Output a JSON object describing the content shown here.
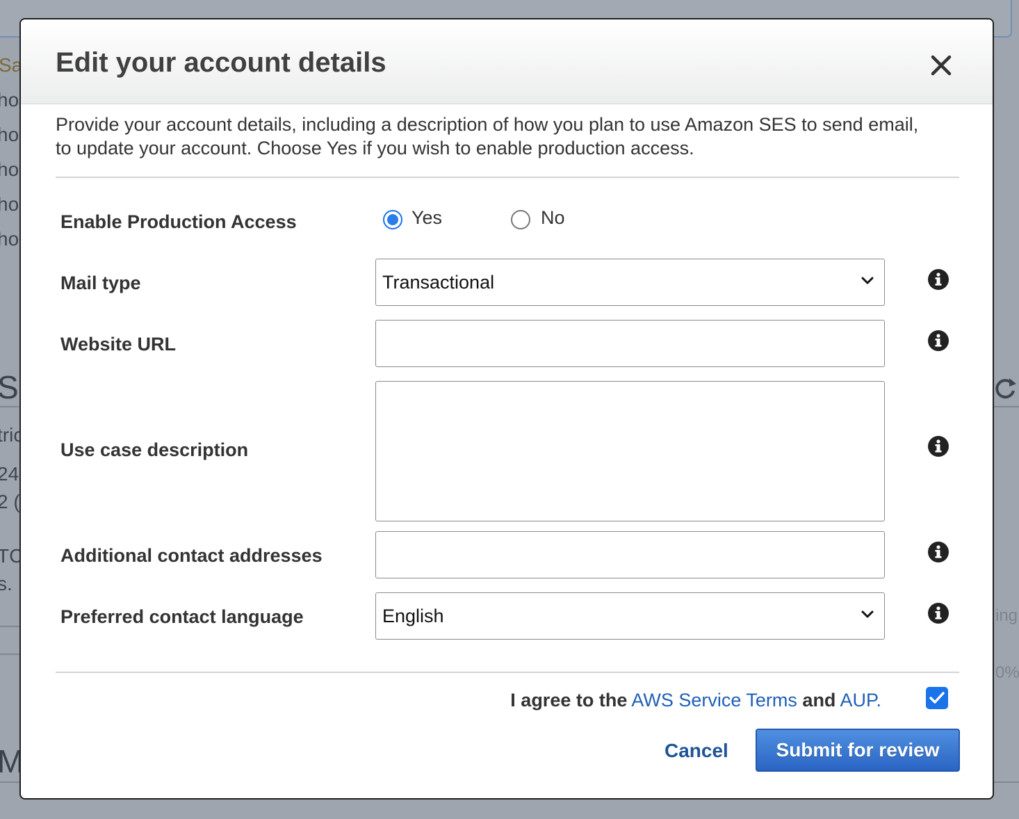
{
  "background": {
    "fragments": [
      "Sar",
      "hor",
      "hor",
      "hor",
      "hor",
      "hor",
      "S",
      "tric",
      "24",
      "2 (",
      "TC",
      "s.",
      "ing",
      "0%",
      "M"
    ]
  },
  "modal": {
    "title": "Edit your account details",
    "intro": "Provide your account details, including a description of how you plan to use Amazon SES to send email, to update your account. Choose Yes if you wish to enable production access.",
    "close_icon": "close-icon"
  },
  "form": {
    "production_access": {
      "label": "Enable Production Access",
      "options": [
        "Yes",
        "No"
      ],
      "selected": "Yes"
    },
    "mail_type": {
      "label": "Mail type",
      "value": "Transactional"
    },
    "website_url": {
      "label": "Website URL",
      "value": ""
    },
    "use_case": {
      "label": "Use case description",
      "value": ""
    },
    "additional_contacts": {
      "label": "Additional contact addresses",
      "value": ""
    },
    "contact_language": {
      "label": "Preferred contact language",
      "value": "English"
    }
  },
  "footer": {
    "agree_prefix": "I agree to the",
    "terms_link": "AWS Service Terms",
    "agree_and": "and",
    "aup_link": "AUP.",
    "agreed": true,
    "cancel_label": "Cancel",
    "submit_label": "Submit for review"
  },
  "colors": {
    "accent": "#1a73e8",
    "link": "#1f5fb8",
    "button": "#2a65c4"
  }
}
